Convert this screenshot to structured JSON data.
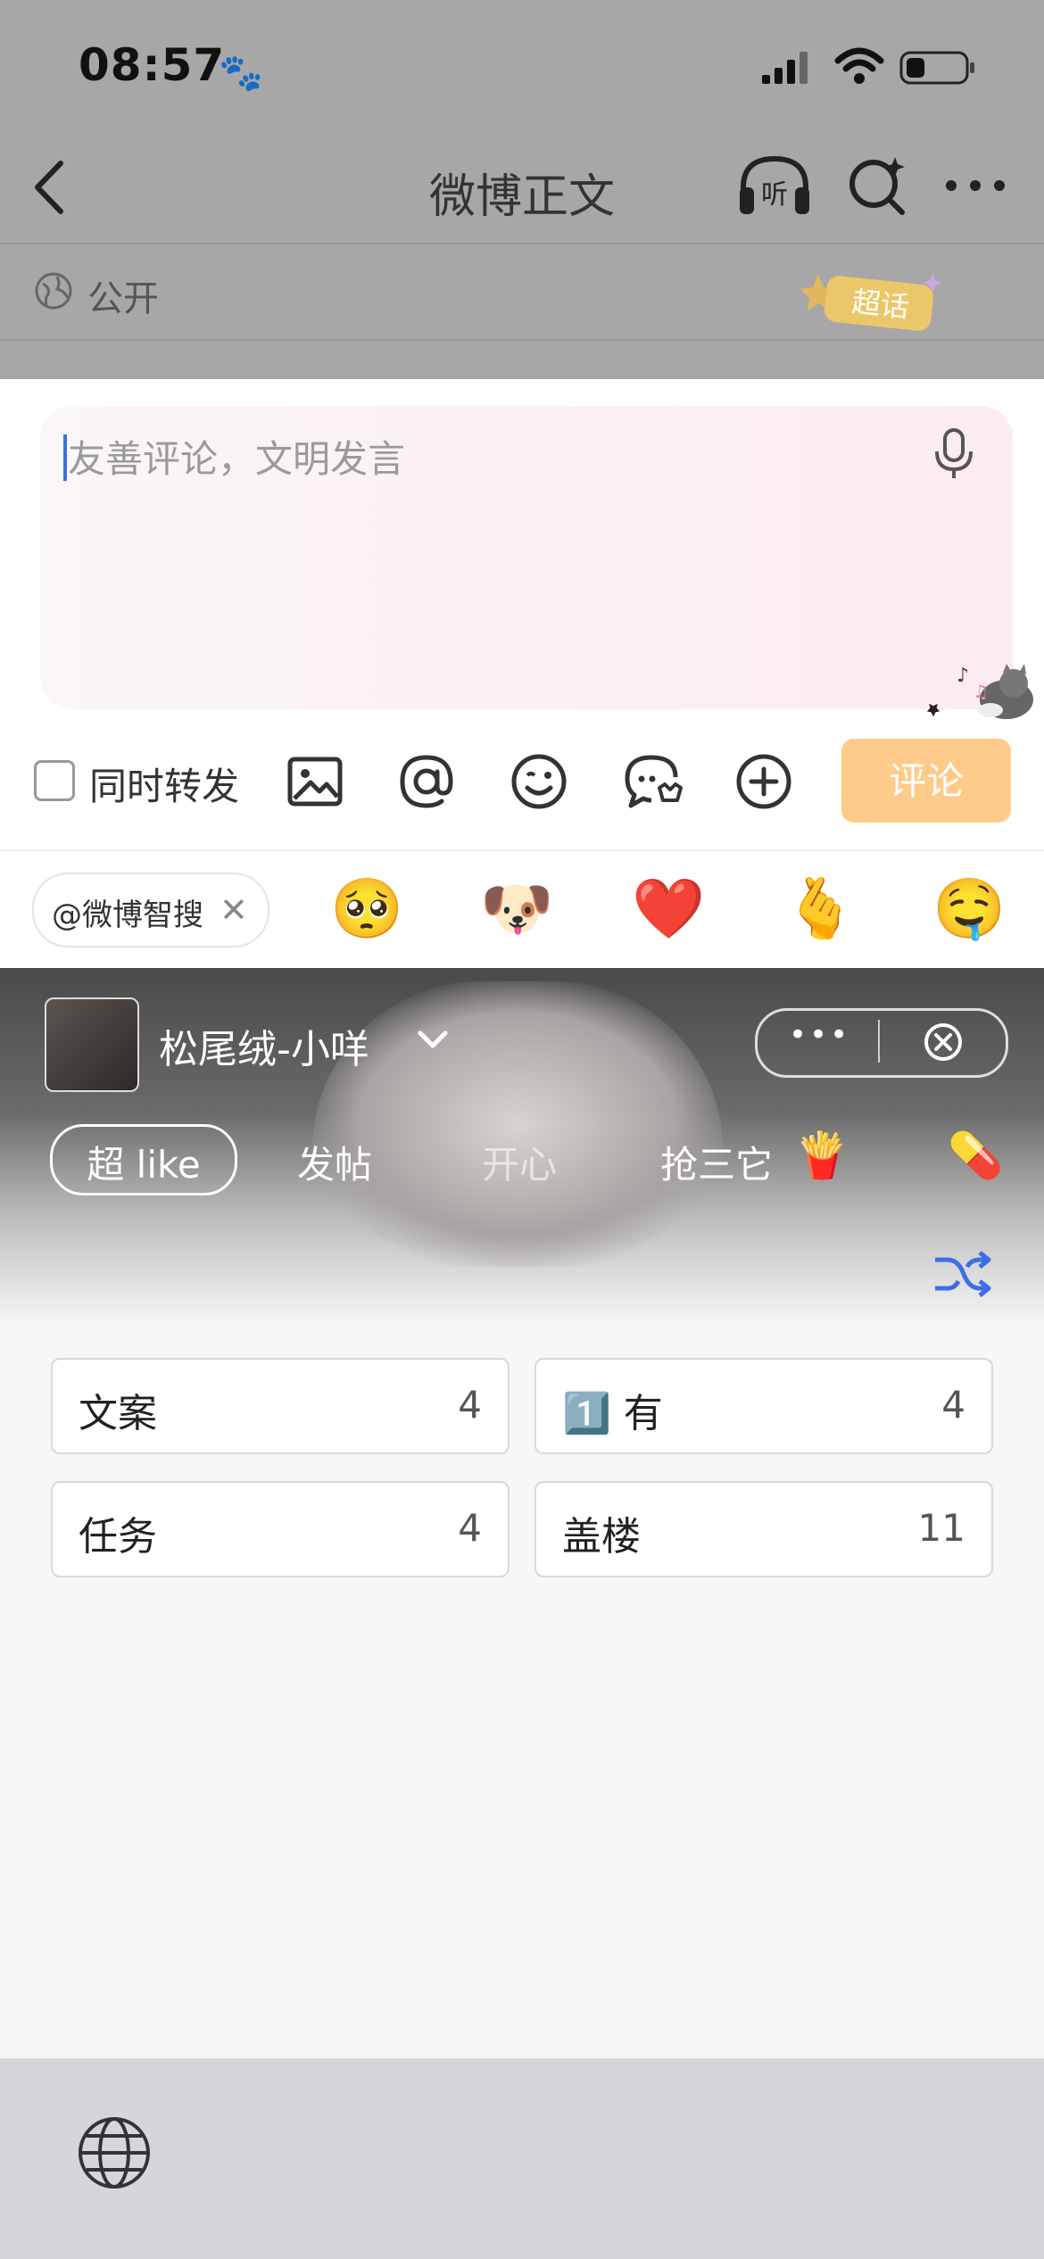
{
  "status_bar": {
    "time": "08:57"
  },
  "nav": {
    "title": "微博正文"
  },
  "visibility": {
    "label": "公开",
    "badge": "超话"
  },
  "comment": {
    "placeholder": "友善评论，文明发言",
    "repost_label": "同时转发",
    "submit_label": "评论"
  },
  "suggestions": {
    "chip_label": "@微博智搜",
    "emojis": [
      "🥺",
      "🐶",
      "❤️",
      "🫰",
      "🤤"
    ]
  },
  "keyboard": {
    "profile_name": "松尾绒-小咩",
    "chips": [
      {
        "label": "超 like"
      },
      {
        "label": "发帖"
      },
      {
        "label": "开心"
      },
      {
        "label": "抢三它"
      }
    ],
    "chip_emojis": [
      "🍟",
      "💊"
    ],
    "categories": [
      {
        "label": "文案",
        "count": "4"
      },
      {
        "label": "1️⃣ 有",
        "count": "4"
      },
      {
        "label": "任务",
        "count": "4"
      },
      {
        "label": "盖楼",
        "count": "11"
      }
    ]
  },
  "colors": {
    "accent_blue": "#3c6ee8",
    "comment_button": "#ffcb8a"
  }
}
